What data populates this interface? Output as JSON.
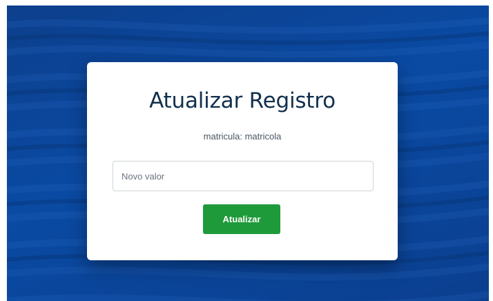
{
  "form": {
    "title": "Atualizar Registro",
    "subtitle": "matricula: matricola",
    "input_placeholder": "Novo valor",
    "input_value": "",
    "submit_label": "Atualizar"
  },
  "colors": {
    "background": "#0a4aa3",
    "card": "#ffffff",
    "title": "#12304f",
    "button": "#1f9a3b",
    "button_text": "#ffffff"
  }
}
